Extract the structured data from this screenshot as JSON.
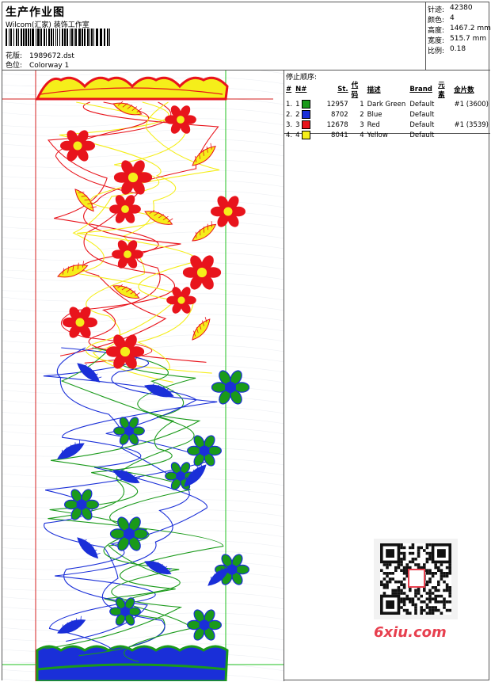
{
  "header": {
    "title": "生产作业图",
    "company": "Wilcom(汇家) 装饰工作室",
    "design_label": "花版:",
    "design_value": "1989672.dst",
    "colorway_label": "色位:",
    "colorway_value": "Colorway 1"
  },
  "stats": [
    {
      "label": "针迹:",
      "value": "42380"
    },
    {
      "label": "颜色:",
      "value": "4"
    },
    {
      "label": "高度:",
      "value": "1467.2 mm"
    },
    {
      "label": "宽度:",
      "value": "515.7 mm"
    },
    {
      "label": "比例:",
      "value": "0.18"
    }
  ],
  "order": {
    "title": "停止顺序:",
    "columns": [
      "#",
      "N#",
      "St.",
      "代码",
      "描述",
      "Brand",
      "元素",
      "金片数"
    ],
    "rows": [
      {
        "num": "1.",
        "n": "1",
        "color": "#1a9a1a",
        "st": "12957",
        "code": "1",
        "desc": "Dark Green",
        "brand": "Default",
        "elem": "",
        "sequin": "#1 (3600)"
      },
      {
        "num": "2.",
        "n": "2",
        "color": "#1a2fd8",
        "st": "8702",
        "code": "2",
        "desc": "Blue",
        "brand": "Default",
        "elem": "",
        "sequin": ""
      },
      {
        "num": "3.",
        "n": "3",
        "color": "#e8141c",
        "st": "12678",
        "code": "3",
        "desc": "Red",
        "brand": "Default",
        "elem": "",
        "sequin": "#1 (3539)"
      },
      {
        "num": "4.",
        "n": "4",
        "color": "#f5ee1a",
        "st": "8041",
        "code": "4",
        "desc": "Yellow",
        "brand": "Default",
        "elem": "",
        "sequin": ""
      }
    ]
  },
  "design": {
    "thread_colors": {
      "green": "#1a9a1a",
      "blue": "#1a2fd8",
      "red": "#e8141c",
      "yellow": "#f5ee1a"
    },
    "guide_colors": {
      "red_line": "#d42020",
      "green_line": "#22c022"
    }
  },
  "watermark": {
    "text": "6xiu.com",
    "stamp": "回味阁",
    "color": "#e73f4e"
  }
}
